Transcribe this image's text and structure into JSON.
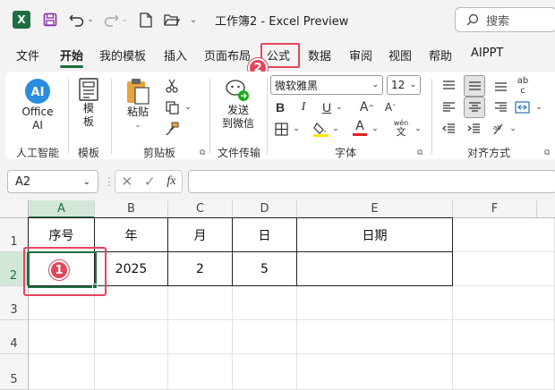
{
  "titlebar": {
    "app_logo": "X",
    "title": "工作簿2 - Excel Preview",
    "search_placeholder": "搜索",
    "icons": [
      "excel-logo-icon",
      "save-icon",
      "undo-icon",
      "redo-icon",
      "new-file-icon",
      "open-folder-icon",
      "customize-chevron-icon",
      "search-icon"
    ]
  },
  "tabs": [
    "文件",
    "开始",
    "我的模板",
    "插入",
    "页面布局",
    "公式",
    "数据",
    "审阅",
    "视图",
    "帮助",
    "AIPPT"
  ],
  "active_tab": "开始",
  "annotations": {
    "marker_1": "1",
    "marker_2": "2"
  },
  "ribbon": {
    "ai_group": {
      "button": "Office AI",
      "button_line1": "Office",
      "button_line2": "AI",
      "label": "人工智能"
    },
    "template_group": {
      "button_line1": "模",
      "button_line2": "板",
      "label": "模板"
    },
    "clipboard_group": {
      "paste_label": "粘贴",
      "label": "剪贴板"
    },
    "transfer_group": {
      "button_line1": "发送",
      "button_line2": "到微信",
      "label": "文件传输"
    },
    "font_group": {
      "font_name": "微软雅黑",
      "font_size": "12",
      "label": "字体",
      "bold": "B",
      "italic": "I",
      "underline": "U",
      "font_color": "A",
      "wen_top": "wén",
      "wen_bottom": "文"
    },
    "align_group": {
      "label": "对齐方式",
      "wrap_label": "ab",
      "wrap_label2": "c"
    }
  },
  "formula_bar": {
    "name_box": "A2",
    "fx": "fx",
    "formula": ""
  },
  "grid": {
    "columns": [
      "A",
      "B",
      "C",
      "D",
      "E",
      "F"
    ],
    "rows": [
      "1",
      "2",
      "3",
      "4",
      "5"
    ],
    "selected_column": "A",
    "selected_row": "2",
    "headers_row": [
      "序号",
      "年",
      "月",
      "日",
      "日期"
    ],
    "data_row": [
      "",
      "2025",
      "2",
      "5",
      ""
    ]
  },
  "colors": {
    "accent": "#1d6f42",
    "annotation": "#e2465a"
  }
}
